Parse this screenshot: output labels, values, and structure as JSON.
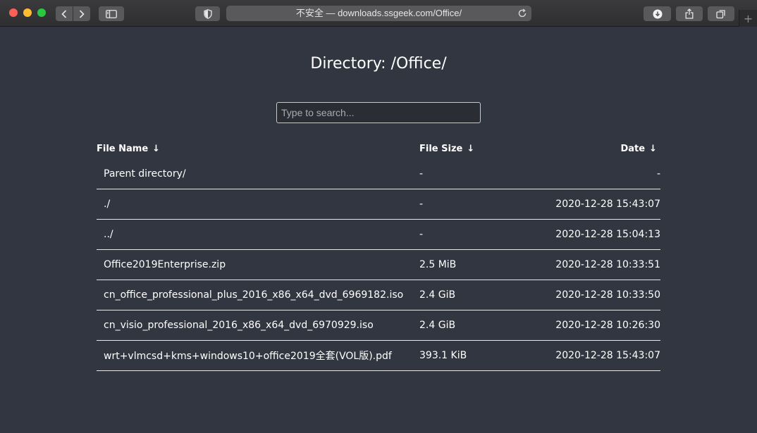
{
  "browser": {
    "address": "不安全 — downloads.ssgeek.com/Office/",
    "new_tab": "+"
  },
  "page": {
    "title": "Directory: /Office/",
    "search_placeholder": "Type to search..."
  },
  "table": {
    "headers": {
      "name": "File Name",
      "size": "File Size",
      "date": "Date",
      "sort_arrow": "↓"
    },
    "rows": [
      {
        "name": "Parent directory/",
        "size": "-",
        "date": "-"
      },
      {
        "name": "./",
        "size": "-",
        "date": "2020-12-28 15:43:07"
      },
      {
        "name": "../",
        "size": "-",
        "date": "2020-12-28 15:04:13"
      },
      {
        "name": "Office2019Enterprise.zip",
        "size": "2.5 MiB",
        "date": "2020-12-28 10:33:51"
      },
      {
        "name": "cn_office_professional_plus_2016_x86_x64_dvd_6969182.iso",
        "size": "2.4 GiB",
        "date": "2020-12-28 10:33:50"
      },
      {
        "name": "cn_visio_professional_2016_x86_x64_dvd_6970929.iso",
        "size": "2.4 GiB",
        "date": "2020-12-28 10:26:30"
      },
      {
        "name": "wrt+vlmcsd+kms+windows10+office2019全套(VOL版).pdf",
        "size": "393.1 KiB",
        "date": "2020-12-28 15:43:07"
      }
    ]
  },
  "colors": {
    "background": "#323640",
    "text": "#ffffff",
    "row_border": "#e8e8e8"
  }
}
